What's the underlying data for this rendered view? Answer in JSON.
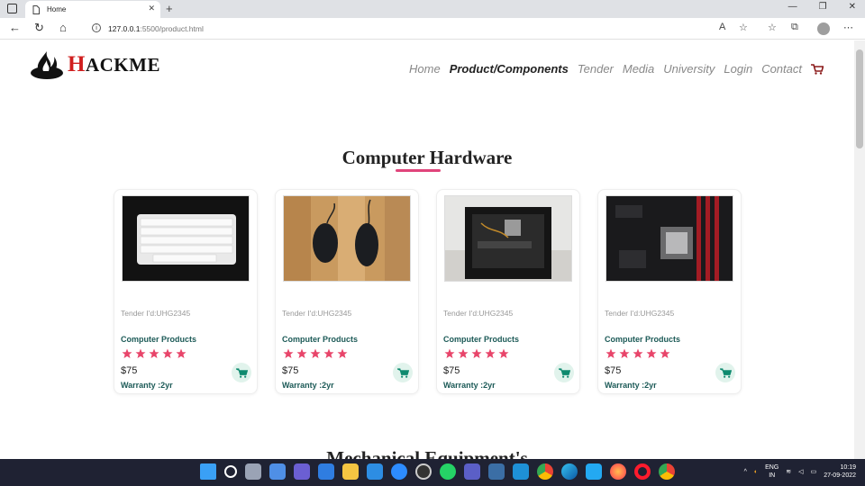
{
  "browser": {
    "tab_title": "Home",
    "tab_close": "✕",
    "new_tab": "+",
    "url": "127.0.0.1:5500/product.html",
    "url_host": "127.0.0.1",
    "url_path": ":5500/product.html",
    "window_buttons": [
      "—",
      "❐",
      "✕"
    ]
  },
  "site": {
    "logo_first_letter": "H",
    "logo_rest": "ACKME",
    "nav": [
      "Home",
      "Product/Components",
      "Tender",
      "Media",
      "University",
      "Login",
      "Contact"
    ],
    "active_nav": "Product/Components"
  },
  "section": {
    "title": "Computer Hardware",
    "next_title": "Mechanical Equipment's"
  },
  "products": [
    {
      "tender": "Tender I'd:UHG2345",
      "category": "Computer Products",
      "rating": 5,
      "price": "$75",
      "warranty": "Warranty :2yr",
      "image": "keyboard"
    },
    {
      "tender": "Tender I'd:UHG2345",
      "category": "Computer Products",
      "rating": 5,
      "price": "$75",
      "warranty": "Warranty :2yr",
      "image": "mouse"
    },
    {
      "tender": "Tender I'd:UHG2345",
      "category": "Computer Products",
      "rating": 5,
      "price": "$75",
      "warranty": "Warranty :2yr",
      "image": "pc-case"
    },
    {
      "tender": "Tender I'd:UHG2345",
      "category": "Computer Products",
      "rating": 5,
      "price": "$75",
      "warranty": "Warranty :2yr",
      "image": "motherboard"
    }
  ],
  "taskbar": {
    "lang_top": "ENG",
    "lang_bottom": "IN",
    "time": "10:19",
    "date": "27-09-2022"
  },
  "colors": {
    "accent_pink": "#e0457b",
    "teal": "#1c5a57",
    "cart_green": "#0f8a6f",
    "logo_red": "#d01f1f",
    "cart_nav": "#8b1a1a"
  }
}
